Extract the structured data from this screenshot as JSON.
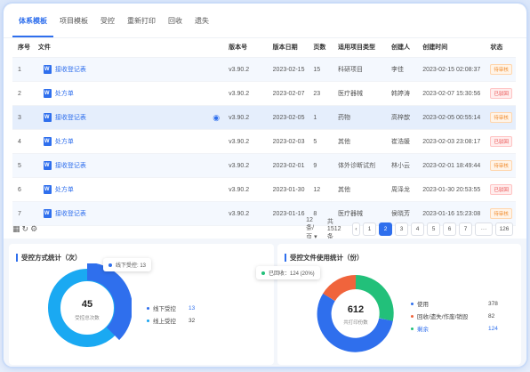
{
  "tabs": [
    "体系模板",
    "项目模板",
    "受控",
    "重新打印",
    "回收",
    "遗失"
  ],
  "table": {
    "headers": [
      "序号",
      "文件",
      "版本号",
      "版本日期",
      "页数",
      "适用项目类型",
      "创建人",
      "创建时间",
      "状态"
    ],
    "rows": [
      {
        "idx": "1",
        "file": "接收登记表",
        "ver": "v3.90.2",
        "date": "2023-02-15",
        "pages": "15",
        "type": "科研项目",
        "creator": "李佳",
        "ctime": "2023-02-15 02:08:37",
        "status": "待审核",
        "status_color": "orange"
      },
      {
        "idx": "2",
        "file": "处方单",
        "ver": "v3.90.2",
        "date": "2023-02-07",
        "pages": "23",
        "type": "医疗器械",
        "creator": "韩婷涛",
        "ctime": "2023-02-07 15:30:56",
        "status": "已驳回",
        "status_color": "red"
      },
      {
        "idx": "3",
        "file": "接收登记表",
        "ver": "v3.90.2",
        "date": "2023-02-05",
        "pages": "1",
        "type": "药物",
        "creator": "高梓歆",
        "ctime": "2023-02-05 00:55:14",
        "status": "待审核",
        "status_color": "orange"
      },
      {
        "idx": "4",
        "file": "处方单",
        "ver": "v3.90.2",
        "date": "2023-02-03",
        "pages": "5",
        "type": "其他",
        "creator": "崔浩媛",
        "ctime": "2023-02-03 23:08:17",
        "status": "已驳回",
        "status_color": "red"
      },
      {
        "idx": "5",
        "file": "接收登记表",
        "ver": "v3.90.2",
        "date": "2023-02-01",
        "pages": "9",
        "type": "体外诊断试剂",
        "creator": "林小云",
        "ctime": "2023-02-01 18:49:44",
        "status": "待审核",
        "status_color": "orange"
      },
      {
        "idx": "6",
        "file": "处方单",
        "ver": "v3.90.2",
        "date": "2023-01-30",
        "pages": "12",
        "type": "其他",
        "creator": "周泽龙",
        "ctime": "2023-01-30 20:53:55",
        "status": "已驳回",
        "status_color": "red"
      },
      {
        "idx": "7",
        "file": "接收登记表",
        "ver": "v3.90.2",
        "date": "2023-01-16",
        "pages": "8",
        "type": "医疗器械",
        "creator": "侯晓芳",
        "ctime": "2023-01-16 15:23:08",
        "status": "待审核",
        "status_color": "orange"
      }
    ]
  },
  "pager": {
    "page_size": "12条/页 ▾",
    "total": "共 1512 条",
    "pages": [
      "1",
      "2",
      "3",
      "4",
      "5",
      "6",
      "7",
      "···",
      "126"
    ],
    "active_page": "2"
  },
  "left_panel": {
    "title": "受控方式统计（次）",
    "center_value": "45",
    "center_label": "受控总次数",
    "legend": [
      {
        "label": "线下受控",
        "value": "13",
        "color": "#2f6fed"
      },
      {
        "label": "线上受控",
        "value": "32",
        "color": "#17a3f0"
      }
    ],
    "tooltip": "线下受控: 13"
  },
  "right_panel": {
    "title": "受控文件使用统计（份）",
    "center_value": "612",
    "center_label": "共打印份数",
    "legend": [
      {
        "label": "使用",
        "value": "378",
        "color": "#2f6fed"
      },
      {
        "label": "回收/遗失/作废/销毁",
        "value": "82",
        "color": "#f0643c"
      },
      {
        "label": "剩余",
        "value": "124",
        "color": "#22c07a"
      }
    ],
    "tooltip": "已回收：124 (20%)"
  }
}
